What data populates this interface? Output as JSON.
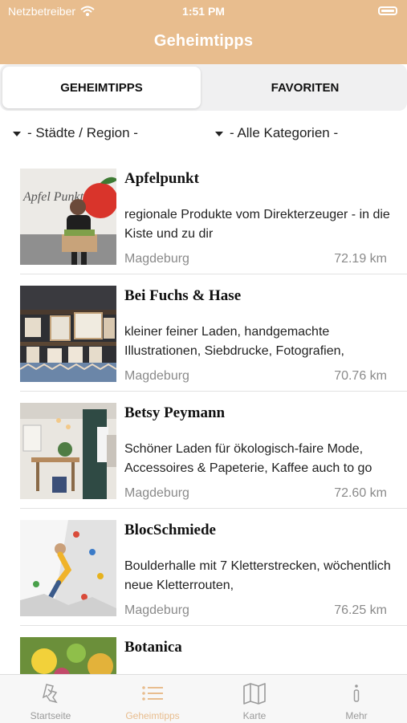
{
  "status_bar": {
    "carrier": "Netzbetreiber",
    "time": "1:51 PM"
  },
  "header": {
    "title": "Geheimtipps"
  },
  "segments": {
    "active": "GEHEIMTIPPS",
    "inactive": "FAVORITEN"
  },
  "filters": {
    "region": "- Städte / Region -",
    "category": "- Alle Kategorien -"
  },
  "items": [
    {
      "name": "Apfelpunkt",
      "desc": "regionale Produkte vom Direkterzeuger - in die Kiste und zu dir",
      "city": "Magdeburg",
      "distance": "72.19 km"
    },
    {
      "name": "Bei Fuchs & Hase",
      "desc": "kleiner feiner Laden, handgemachte Illustrationen, Siebdrucke, Fotografien,",
      "city": "Magdeburg",
      "distance": "70.76 km"
    },
    {
      "name": "Betsy Peymann",
      "desc": "Schöner Laden für ökologisch-faire Mode, Accessoires & Papeterie, Kaffee auch to go",
      "city": "Magdeburg",
      "distance": "72.60 km"
    },
    {
      "name": "BlocSchmiede",
      "desc": "Boulderhalle mit 7 Kletterstrecken, wöchentlich neue Kletterrouten,",
      "city": "Magdeburg",
      "distance": "76.25 km"
    },
    {
      "name": "Botanica",
      "desc": "",
      "city": "",
      "distance": ""
    }
  ],
  "tabs": [
    {
      "label": "Startseite",
      "icon": "home-icon"
    },
    {
      "label": "Geheimtipps",
      "icon": "list-icon"
    },
    {
      "label": "Karte",
      "icon": "map-icon"
    },
    {
      "label": "Mehr",
      "icon": "info-icon"
    }
  ],
  "colors": {
    "accent": "#e8bd8e",
    "separator": "#e2e2e2",
    "muted": "#8a8a8a"
  }
}
